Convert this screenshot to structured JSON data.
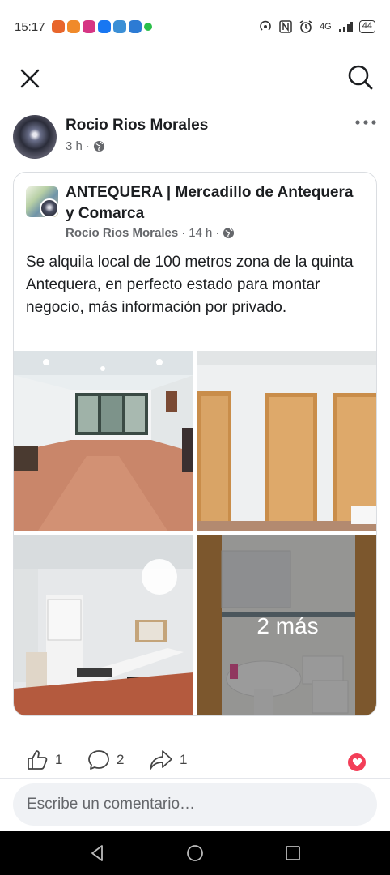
{
  "status_bar": {
    "time": "15:17",
    "network": "4G",
    "battery": "44",
    "app_colors": [
      "#e8662c",
      "#f08a2a",
      "#d63584",
      "#1877f2",
      "#3b8fd6",
      "#2d7bd4",
      "#2bbf4a"
    ]
  },
  "post": {
    "author": "Rocio Rios Morales",
    "time": "3 h",
    "audience_icon": "globe-icon"
  },
  "shared": {
    "group_name": "ANTEQUERA | Mercadillo de Antequera y Comarca",
    "author": "Rocio Rios Morales",
    "time": "14 h",
    "text": "Se alquila local de 100 metros zona de la quinta Antequera, en perfecto estado para montar negocio, más información por privado.",
    "more_photos": "2 más"
  },
  "reactions": {
    "likes": "1",
    "comments": "2",
    "shares": "1",
    "reaction_color": "#f33e58"
  },
  "comment": {
    "placeholder": "Escribe un comentario…"
  },
  "colors": {
    "secondary_text": "#65676b",
    "primary_text": "#1c1e21",
    "comment_bg": "#f0f2f5"
  }
}
